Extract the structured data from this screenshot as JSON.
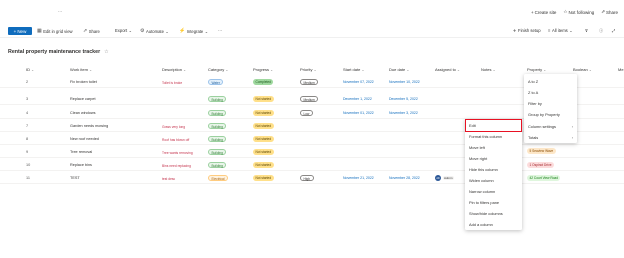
{
  "top": {
    "dots": "...",
    "create_site": "Create site",
    "not_following": "Not following",
    "share": "Share"
  },
  "toolbar": {
    "new": "New",
    "edit_grid": "Edit in grid view",
    "share": "Share",
    "export": "Export",
    "automate": "Automate",
    "integrate": "Integrate",
    "more": "···",
    "finish_setup": "Finish setup",
    "all_items": "All items"
  },
  "list": {
    "title": "Rental property maintenance tracker"
  },
  "columns": {
    "id": "ID",
    "work_item": "Work item",
    "description": "Description",
    "category": "Category",
    "progress": "Progress",
    "priority": "Priority",
    "start_date": "Start date",
    "due_date": "Due date",
    "assigned_to": "Assigned to",
    "notes": "Notes",
    "property": "Property",
    "boolean": "Boolean",
    "more": "Me"
  },
  "rows": [
    {
      "id": "2",
      "work_item": "Fix broken toilet",
      "description": "Toilet is broke",
      "category": "Water",
      "progress": "Completed",
      "priority": "Medium",
      "start_date": "November 07, 2022",
      "due_date": "November 10, 2022",
      "property": ""
    },
    {
      "id": "3",
      "work_item": "Replace carpet",
      "description": "",
      "category": "Building",
      "progress": "Not started",
      "priority": "Medium",
      "start_date": "December 1, 2022",
      "due_date": "December 5, 2022",
      "property": ""
    },
    {
      "id": "4",
      "work_item": "Clean windows",
      "description": "",
      "category": "Building",
      "progress": "Not started",
      "priority": "Low",
      "start_date": "November 01, 2022",
      "due_date": "November 3, 2022",
      "property": ""
    },
    {
      "id": "7",
      "work_item": "Garden needs mowing",
      "description": "Grass very long",
      "category": "Building",
      "progress": "Not started",
      "priority": "",
      "start_date": "",
      "due_date": "",
      "property": ""
    },
    {
      "id": "8",
      "work_item": "New roof needed",
      "description": "Roof has blown off",
      "category": "Building",
      "progress": "Not started",
      "priority": "",
      "start_date": "",
      "due_date": "",
      "property": "5 Seaview Wave"
    },
    {
      "id": "9",
      "work_item": "Tree removal",
      "description": "Tree wants removing",
      "category": "Building",
      "progress": "Not started",
      "priority": "",
      "start_date": "",
      "due_date": "",
      "property": ""
    },
    {
      "id": "10",
      "work_item": "Replace bins",
      "description": "Bins need replacing",
      "category": "Building",
      "progress": "Not started",
      "priority": "",
      "start_date": "",
      "due_date": "",
      "property": "1 Ospinot Drive"
    },
    {
      "id": "11",
      "work_item": "TEST",
      "description": "test desc",
      "category": "Electrical",
      "progress": "Not started",
      "priority": "High",
      "start_date": "November 21, 2022",
      "due_date": "November 28, 2022",
      "assigned": "Admin",
      "initials": "AD",
      "property": "42 Court View Road"
    }
  ],
  "sort_menu": {
    "items": [
      "A to Z",
      "Z to A",
      "Filter by",
      "Group by Property",
      "Column settings",
      "Totals"
    ]
  },
  "col_menu": {
    "items": [
      "Edit",
      "Format this column",
      "Move left",
      "Move right",
      "Hide this column",
      "Widen column",
      "Narrow column",
      "Pin to filters pane",
      "Show/hide columns",
      "Add a column"
    ]
  },
  "colors": {
    "accent": "#0f6cbd",
    "highlight": "#e81123"
  }
}
